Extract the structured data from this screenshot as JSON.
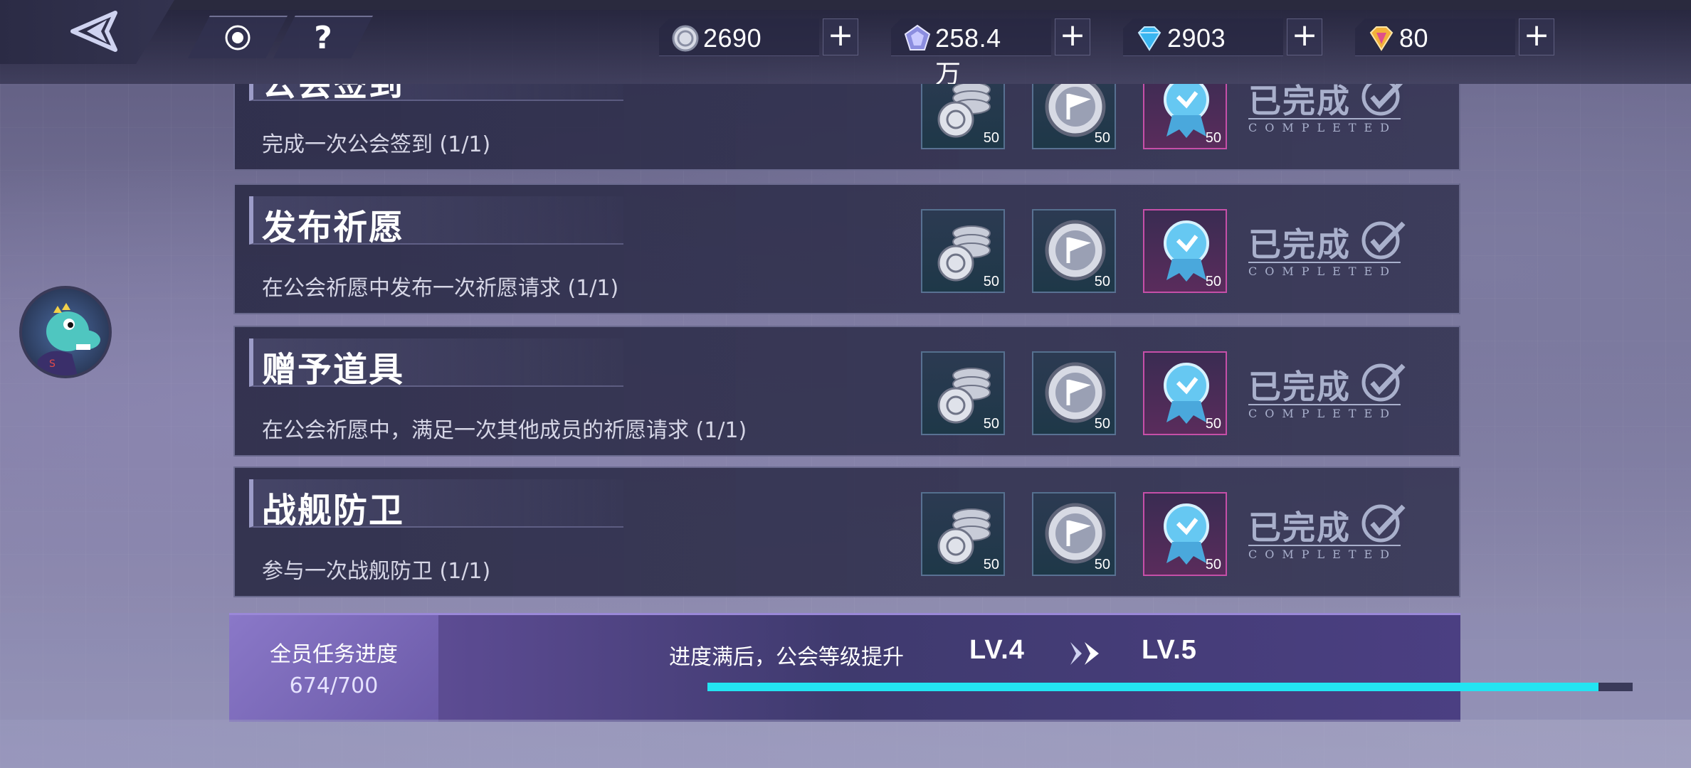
{
  "currencies": [
    {
      "name": "silver-coin",
      "value": "2690",
      "icon": "silver-coin-icon"
    },
    {
      "name": "crystal",
      "value": "258.4万",
      "icon": "crystal-icon"
    },
    {
      "name": "diamond",
      "value": "2903",
      "icon": "diamond-icon"
    },
    {
      "name": "gold-gem",
      "value": "80",
      "icon": "gold-gem-icon"
    }
  ],
  "topbar": {
    "help_label": "?"
  },
  "tasks": [
    {
      "title": "公会签到",
      "desc": "完成一次公会签到 (1/1)",
      "rewards": [
        "50",
        "50",
        "50"
      ]
    },
    {
      "title": "发布祈愿",
      "desc": "在公会祈愿中发布一次祈愿请求 (1/1)",
      "rewards": [
        "50",
        "50",
        "50"
      ]
    },
    {
      "title": "赠予道具",
      "desc": "在公会祈愿中，满足一次其他成员的祈愿请求 (1/1)",
      "rewards": [
        "50",
        "50",
        "50"
      ]
    },
    {
      "title": "战舰防卫",
      "desc": "参与一次战舰防卫 (1/1)",
      "rewards": [
        "50",
        "50",
        "50"
      ]
    }
  ],
  "completed": {
    "zh": "已完成",
    "en": "COMPLETED"
  },
  "progress": {
    "label": "全员任务进度",
    "value": "674/700",
    "current": 674,
    "total": 700,
    "note": "进度满后，公会等级提升",
    "lv_from": "LV.4",
    "lv_to": "LV.5"
  },
  "colors": {
    "progress": "#23e4f2",
    "accent": "#6a57a2"
  }
}
